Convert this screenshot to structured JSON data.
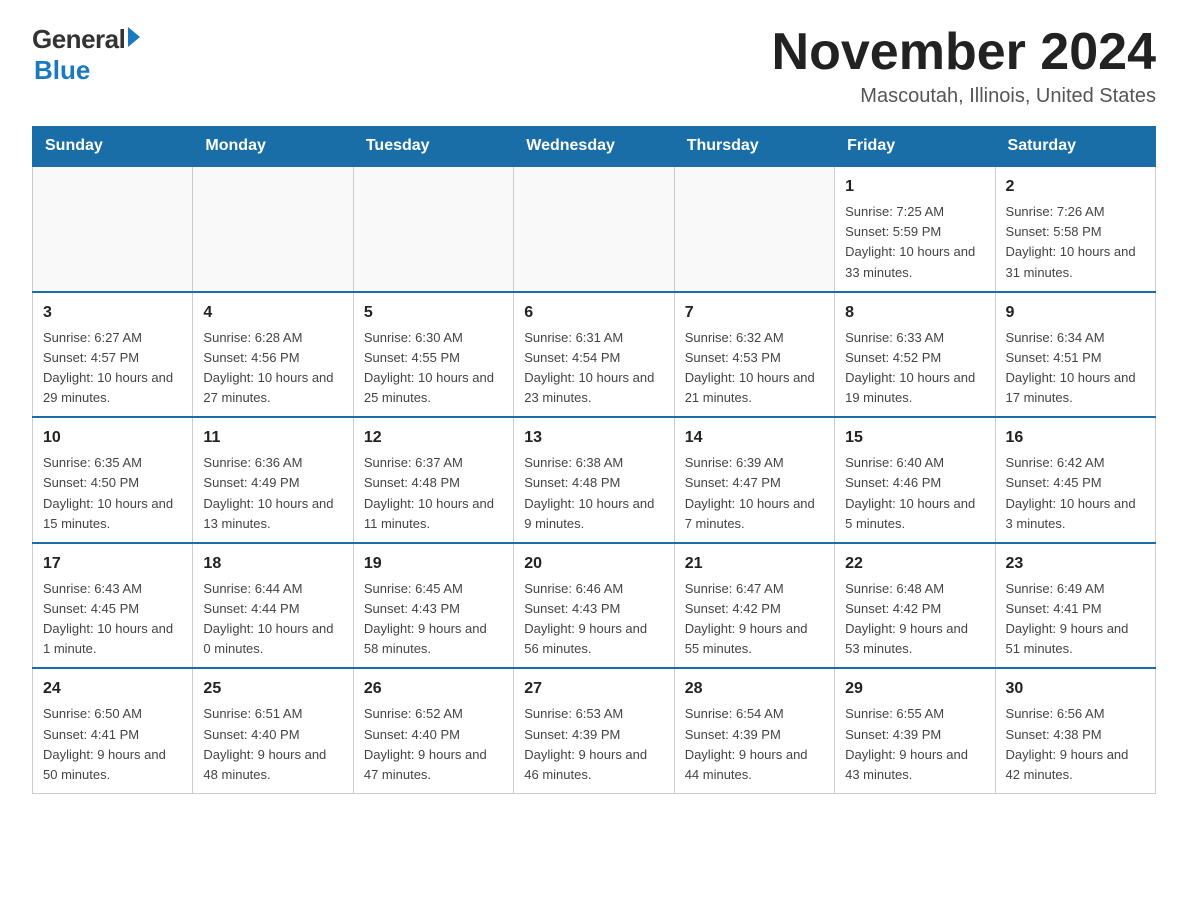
{
  "header": {
    "logo_general": "General",
    "logo_blue": "Blue",
    "month_title": "November 2024",
    "location": "Mascoutah, Illinois, United States"
  },
  "days_of_week": [
    "Sunday",
    "Monday",
    "Tuesday",
    "Wednesday",
    "Thursday",
    "Friday",
    "Saturday"
  ],
  "weeks": [
    [
      {
        "day": "",
        "info": ""
      },
      {
        "day": "",
        "info": ""
      },
      {
        "day": "",
        "info": ""
      },
      {
        "day": "",
        "info": ""
      },
      {
        "day": "",
        "info": ""
      },
      {
        "day": "1",
        "info": "Sunrise: 7:25 AM\nSunset: 5:59 PM\nDaylight: 10 hours and 33 minutes."
      },
      {
        "day": "2",
        "info": "Sunrise: 7:26 AM\nSunset: 5:58 PM\nDaylight: 10 hours and 31 minutes."
      }
    ],
    [
      {
        "day": "3",
        "info": "Sunrise: 6:27 AM\nSunset: 4:57 PM\nDaylight: 10 hours and 29 minutes."
      },
      {
        "day": "4",
        "info": "Sunrise: 6:28 AM\nSunset: 4:56 PM\nDaylight: 10 hours and 27 minutes."
      },
      {
        "day": "5",
        "info": "Sunrise: 6:30 AM\nSunset: 4:55 PM\nDaylight: 10 hours and 25 minutes."
      },
      {
        "day": "6",
        "info": "Sunrise: 6:31 AM\nSunset: 4:54 PM\nDaylight: 10 hours and 23 minutes."
      },
      {
        "day": "7",
        "info": "Sunrise: 6:32 AM\nSunset: 4:53 PM\nDaylight: 10 hours and 21 minutes."
      },
      {
        "day": "8",
        "info": "Sunrise: 6:33 AM\nSunset: 4:52 PM\nDaylight: 10 hours and 19 minutes."
      },
      {
        "day": "9",
        "info": "Sunrise: 6:34 AM\nSunset: 4:51 PM\nDaylight: 10 hours and 17 minutes."
      }
    ],
    [
      {
        "day": "10",
        "info": "Sunrise: 6:35 AM\nSunset: 4:50 PM\nDaylight: 10 hours and 15 minutes."
      },
      {
        "day": "11",
        "info": "Sunrise: 6:36 AM\nSunset: 4:49 PM\nDaylight: 10 hours and 13 minutes."
      },
      {
        "day": "12",
        "info": "Sunrise: 6:37 AM\nSunset: 4:48 PM\nDaylight: 10 hours and 11 minutes."
      },
      {
        "day": "13",
        "info": "Sunrise: 6:38 AM\nSunset: 4:48 PM\nDaylight: 10 hours and 9 minutes."
      },
      {
        "day": "14",
        "info": "Sunrise: 6:39 AM\nSunset: 4:47 PM\nDaylight: 10 hours and 7 minutes."
      },
      {
        "day": "15",
        "info": "Sunrise: 6:40 AM\nSunset: 4:46 PM\nDaylight: 10 hours and 5 minutes."
      },
      {
        "day": "16",
        "info": "Sunrise: 6:42 AM\nSunset: 4:45 PM\nDaylight: 10 hours and 3 minutes."
      }
    ],
    [
      {
        "day": "17",
        "info": "Sunrise: 6:43 AM\nSunset: 4:45 PM\nDaylight: 10 hours and 1 minute."
      },
      {
        "day": "18",
        "info": "Sunrise: 6:44 AM\nSunset: 4:44 PM\nDaylight: 10 hours and 0 minutes."
      },
      {
        "day": "19",
        "info": "Sunrise: 6:45 AM\nSunset: 4:43 PM\nDaylight: 9 hours and 58 minutes."
      },
      {
        "day": "20",
        "info": "Sunrise: 6:46 AM\nSunset: 4:43 PM\nDaylight: 9 hours and 56 minutes."
      },
      {
        "day": "21",
        "info": "Sunrise: 6:47 AM\nSunset: 4:42 PM\nDaylight: 9 hours and 55 minutes."
      },
      {
        "day": "22",
        "info": "Sunrise: 6:48 AM\nSunset: 4:42 PM\nDaylight: 9 hours and 53 minutes."
      },
      {
        "day": "23",
        "info": "Sunrise: 6:49 AM\nSunset: 4:41 PM\nDaylight: 9 hours and 51 minutes."
      }
    ],
    [
      {
        "day": "24",
        "info": "Sunrise: 6:50 AM\nSunset: 4:41 PM\nDaylight: 9 hours and 50 minutes."
      },
      {
        "day": "25",
        "info": "Sunrise: 6:51 AM\nSunset: 4:40 PM\nDaylight: 9 hours and 48 minutes."
      },
      {
        "day": "26",
        "info": "Sunrise: 6:52 AM\nSunset: 4:40 PM\nDaylight: 9 hours and 47 minutes."
      },
      {
        "day": "27",
        "info": "Sunrise: 6:53 AM\nSunset: 4:39 PM\nDaylight: 9 hours and 46 minutes."
      },
      {
        "day": "28",
        "info": "Sunrise: 6:54 AM\nSunset: 4:39 PM\nDaylight: 9 hours and 44 minutes."
      },
      {
        "day": "29",
        "info": "Sunrise: 6:55 AM\nSunset: 4:39 PM\nDaylight: 9 hours and 43 minutes."
      },
      {
        "day": "30",
        "info": "Sunrise: 6:56 AM\nSunset: 4:38 PM\nDaylight: 9 hours and 42 minutes."
      }
    ]
  ]
}
